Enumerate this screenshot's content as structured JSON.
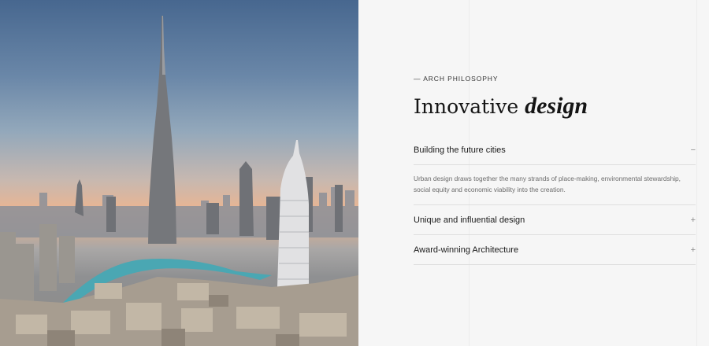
{
  "hero": {
    "icon": "city-skyline-photo"
  },
  "section": {
    "eyebrow": "— ARCH PHILOSOPHY",
    "headline_plain": "Innovative ",
    "headline_emphasis": "design"
  },
  "accordion": [
    {
      "title": "Building the future cities",
      "sign": "−",
      "expanded": true,
      "body": "Urban design draws together the many strands of place-making, environmental stewardship, social equity and economic viability into the creation."
    },
    {
      "title": "Unique and influential design",
      "sign": "+",
      "expanded": false
    },
    {
      "title": "Award-winning Architecture",
      "sign": "+",
      "expanded": false
    }
  ]
}
